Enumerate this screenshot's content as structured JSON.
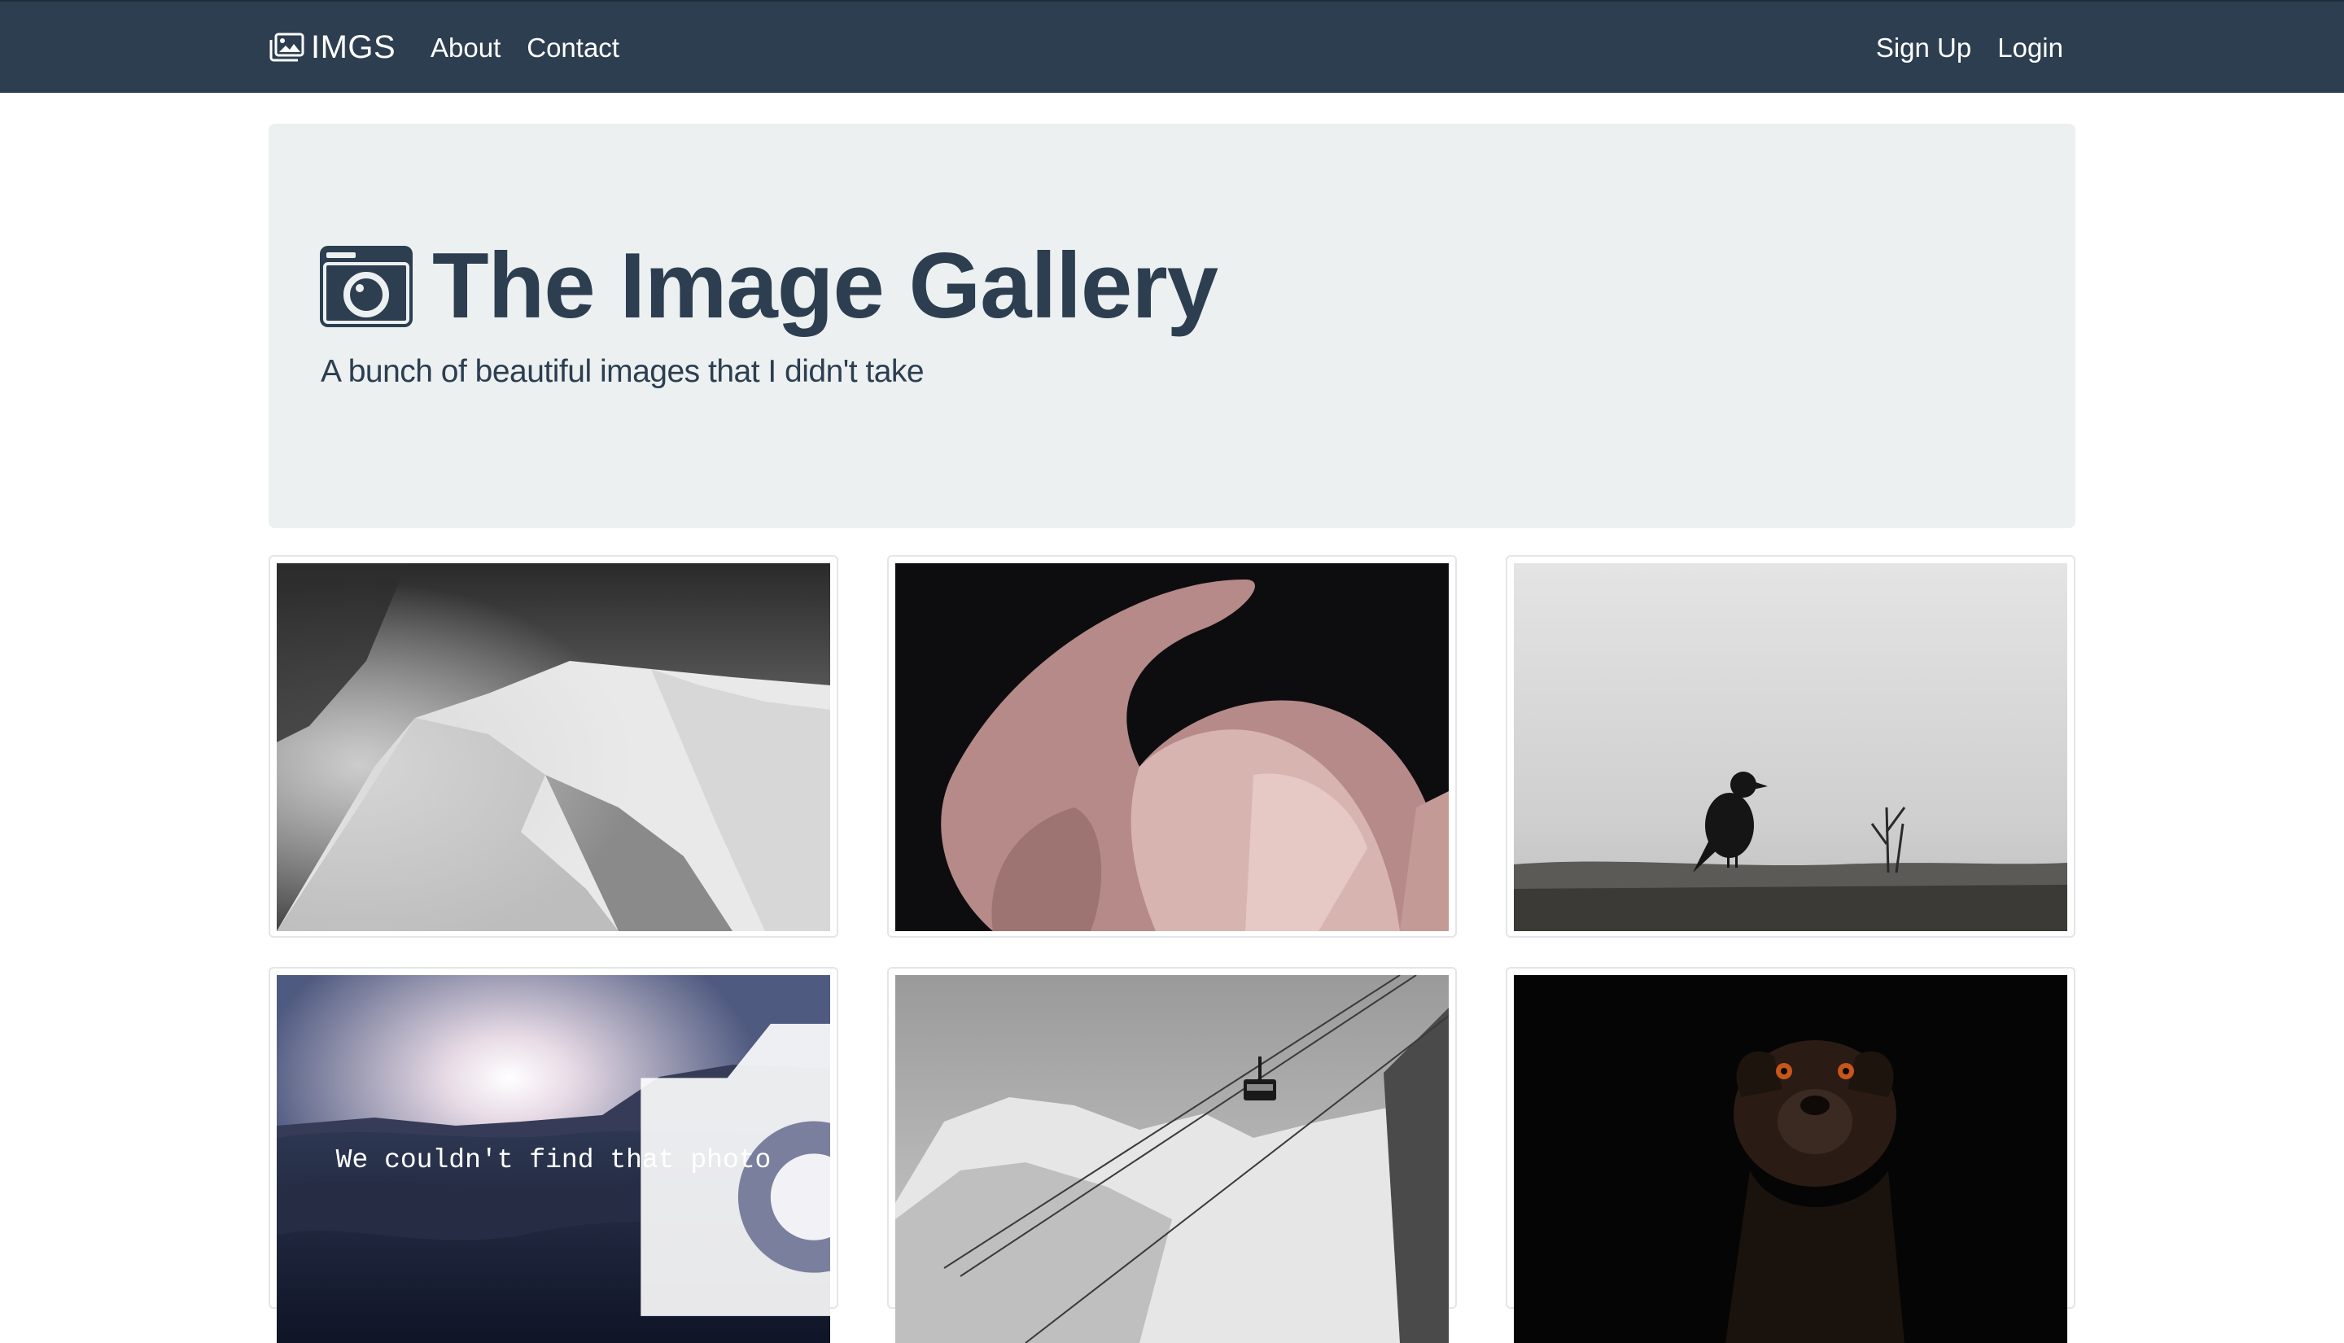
{
  "navbar": {
    "brand": "IMGS",
    "brand_icon": "images-icon",
    "links_left": [
      "About",
      "Contact"
    ],
    "links_right": [
      "Sign Up",
      "Login"
    ],
    "background": "#2c3e50"
  },
  "jumbotron": {
    "title": "The Image Gallery",
    "title_icon": "camera-icon",
    "lead": "A bunch of beautiful images that I didn't take",
    "background": "#ecf0f1"
  },
  "gallery": {
    "items": [
      {
        "subject": "snowy-mountain-ridge"
      },
      {
        "subject": "pink-flamingo-feathers"
      },
      {
        "subject": "crow-on-field"
      },
      {
        "subject": "ocean-sunset",
        "error_text": "We couldn't find that photo",
        "error_icon": "camera-icon"
      },
      {
        "subject": "cable-car-over-mountain"
      },
      {
        "subject": "dog-in-dark"
      }
    ]
  }
}
